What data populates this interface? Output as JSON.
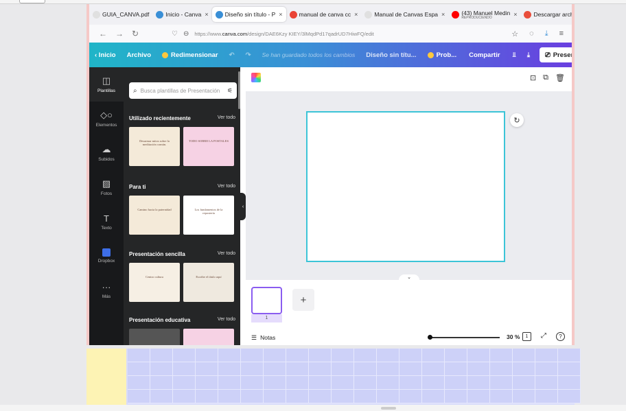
{
  "tabs": [
    {
      "label": "GUIA_CANVA.pdf",
      "icon": "pdf-icon",
      "color": "#e0e0e0"
    },
    {
      "label": "Inicio - Canva",
      "icon": "canva-icon",
      "color": "#3a8fd6"
    },
    {
      "label": "Diseño sin título - P",
      "icon": "canva-icon",
      "color": "#3a8fd6",
      "active": true
    },
    {
      "label": "manual de canva cc",
      "icon": "google-icon",
      "color": "#ea4335"
    },
    {
      "label": "Manual de Canvas Espa",
      "icon": "doc-icon",
      "color": "#e0e0e0"
    },
    {
      "label": "(43) Manuel Medin",
      "sub": "REPRODUCIENDO",
      "icon": "youtube-icon",
      "color": "#ff0000"
    },
    {
      "label": "Descargar archivo |",
      "icon": "download-site-icon",
      "color": "#e94e3c"
    }
  ],
  "tab_close": "×",
  "new_tab": "+",
  "window": {
    "minimize": "−",
    "maximize": "ō",
    "close": "X"
  },
  "url": {
    "prefix": "https://www.",
    "domain": "canva.com",
    "path": "/design/DAE6Kzy KIEY/3lMqdPd17qadrUD7HiwFQ/edit"
  },
  "canva_header": {
    "back": "‹  Inicio",
    "file": "Archivo",
    "resize": "Redimensionar",
    "status": "Se han guardado todos los cambios",
    "title": "Diseño sin títu...",
    "pro": "Prob...",
    "share": "Compartir",
    "present": "Presentar",
    "more": "···"
  },
  "rail": [
    {
      "label": "Plantillas",
      "icon": "templates-icon",
      "glyph": "◫",
      "active": true
    },
    {
      "label": "Elementos",
      "icon": "elements-icon",
      "glyph": "◇○"
    },
    {
      "label": "Subidos",
      "icon": "upload-icon",
      "glyph": "☁"
    },
    {
      "label": "Fotos",
      "icon": "photos-icon",
      "glyph": "▨"
    },
    {
      "label": "Texto",
      "icon": "text-icon",
      "glyph": "T"
    },
    {
      "label": "Dropbox",
      "icon": "dropbox-icon",
      "glyph": ""
    },
    {
      "label": "Más",
      "icon": "more-icon",
      "glyph": "···"
    }
  ],
  "search": {
    "placeholder": "Busca plantillas de Presentación"
  },
  "sections": [
    {
      "title": "Utilizado recientemente",
      "see_all": "Ver todo",
      "thumbs": [
        {
          "text": "Desarmar mitos sobre la meditación común.",
          "bg": "#f4ead9"
        },
        {
          "text": "TODO SOBRE LA POSTALES",
          "bg": "#f6d2e4"
        }
      ]
    },
    {
      "title": "Para ti",
      "see_all": "Ver todo",
      "thumbs": [
        {
          "text": "Camino hacia la paternidad",
          "bg": "#f4ead9"
        },
        {
          "text": "Los fundamentos de la repostería",
          "bg": "#ffffff"
        }
      ]
    },
    {
      "title": "Presentación sencilla",
      "see_all": "Ver todo",
      "thumbs": [
        {
          "text": "Centro cultura",
          "bg": "#f6efe4"
        },
        {
          "text": "Escribe el título aquí",
          "bg": "#efe9df"
        }
      ]
    },
    {
      "title": "Presentación educativa",
      "see_all": "Ver todo",
      "thumbs": [
        {
          "text": "",
          "bg": "#555555"
        },
        {
          "text": "",
          "bg": "#f6d2e4"
        }
      ]
    }
  ],
  "editor": {
    "page_number": "1",
    "add_page": "+",
    "notes": "Notas",
    "zoom": "30 %",
    "page_count": "1",
    "help": "?"
  }
}
